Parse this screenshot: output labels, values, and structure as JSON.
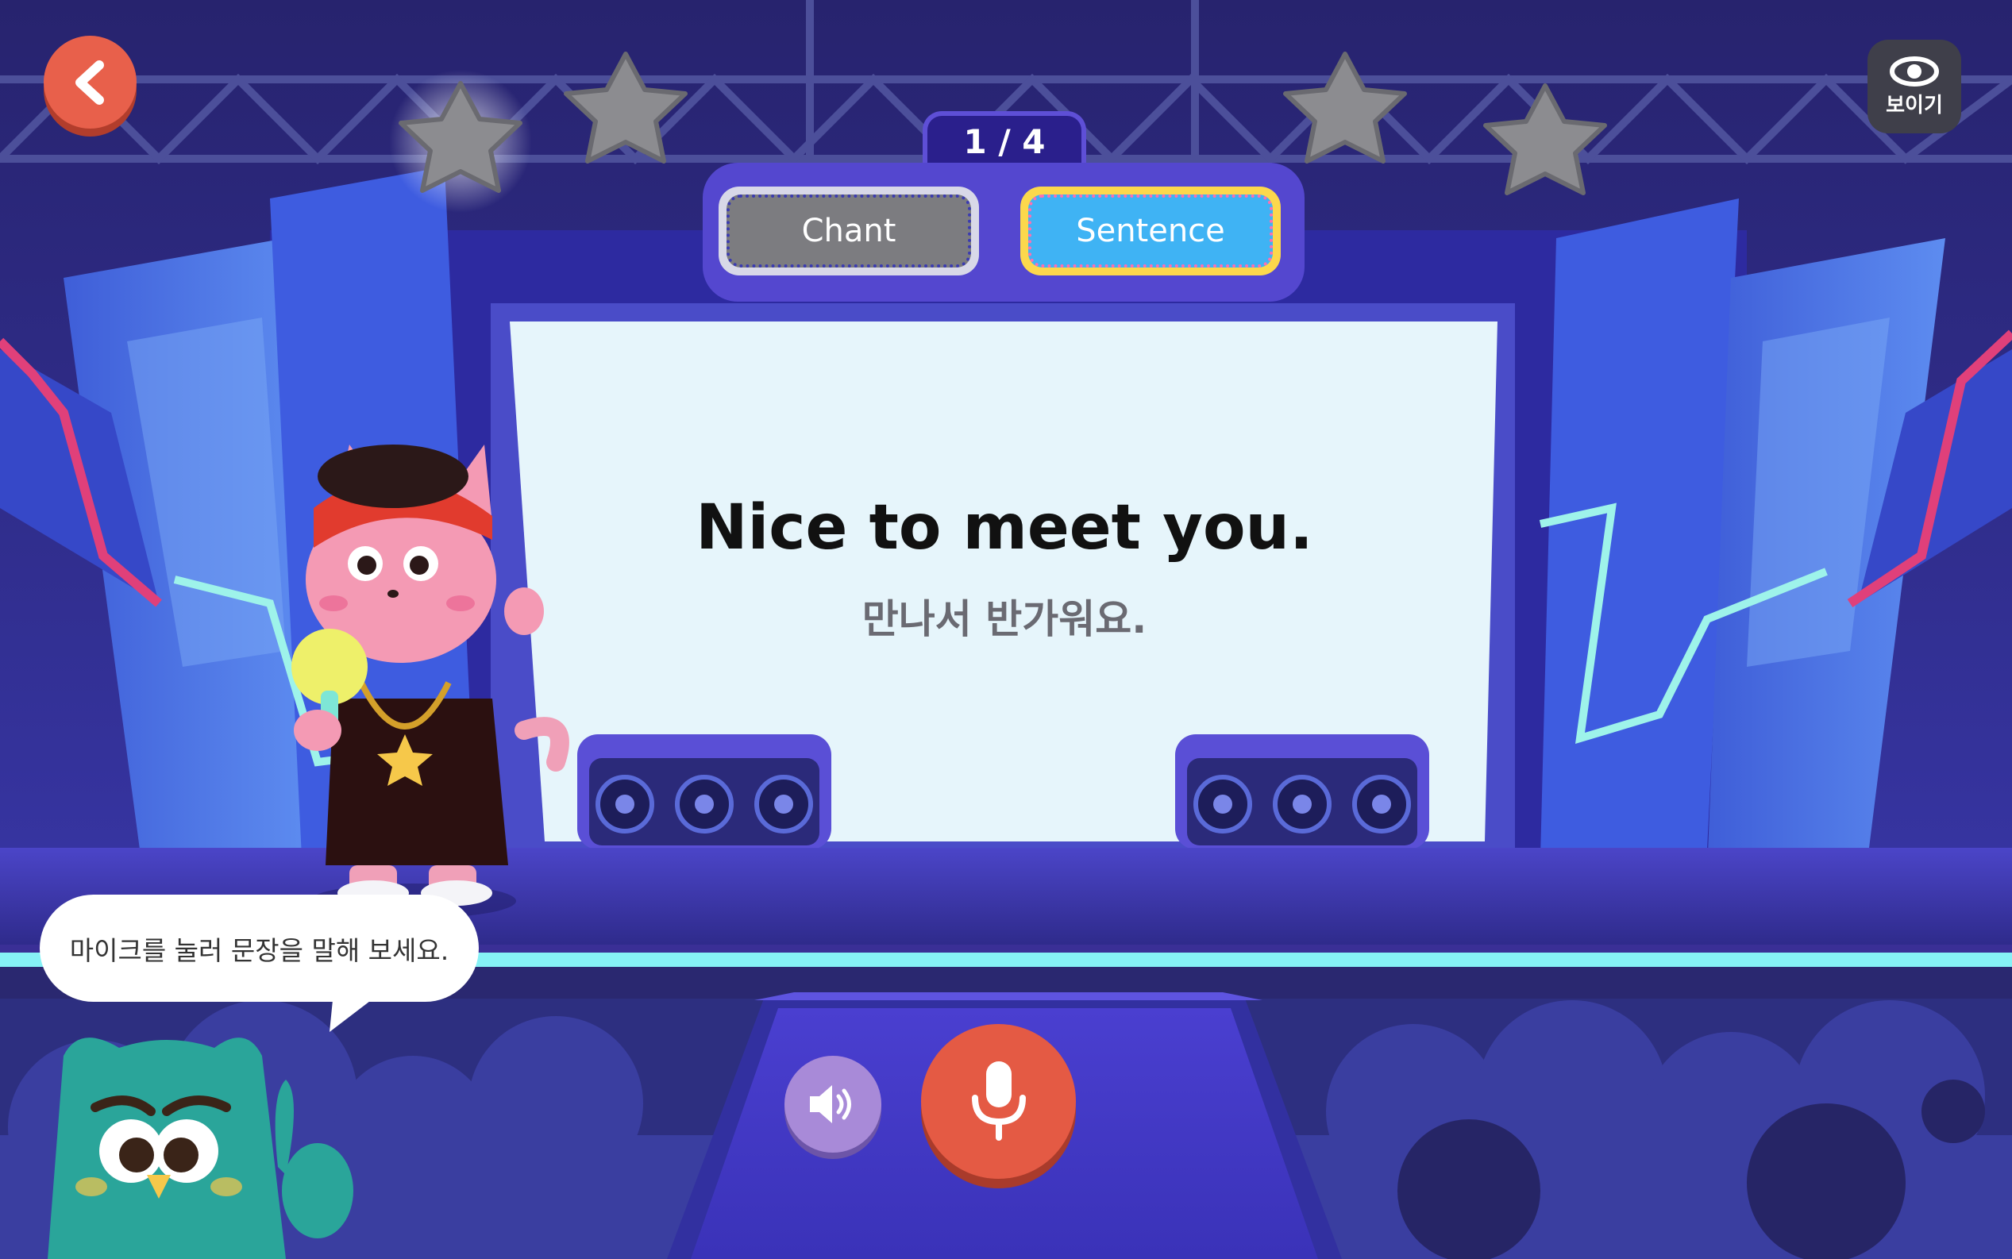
{
  "progress": {
    "text": "1 / 4"
  },
  "tabs": {
    "chant": "Chant",
    "sentence": "Sentence",
    "selected": "Sentence"
  },
  "screen": {
    "english": "Nice to meet you.",
    "korean": "만나서 반가워요."
  },
  "show_button": {
    "label": "보이기",
    "icon": "eye-icon"
  },
  "back_button": {
    "icon": "chevron-left-icon"
  },
  "hint_bubble": {
    "text": "마이크를 눌러 문장을 말해 보세요."
  },
  "controls": {
    "speaker_icon": "speaker-icon",
    "mic_icon": "microphone-icon"
  },
  "stars": {
    "total": 4,
    "earned": 0
  },
  "colors": {
    "accent_red": "#e45a44",
    "tab_active": "#3fb3f4",
    "tab_inactive": "#7c7c80",
    "stage_purple": "#5447cf",
    "screen_bg": "#e6f5fb"
  }
}
